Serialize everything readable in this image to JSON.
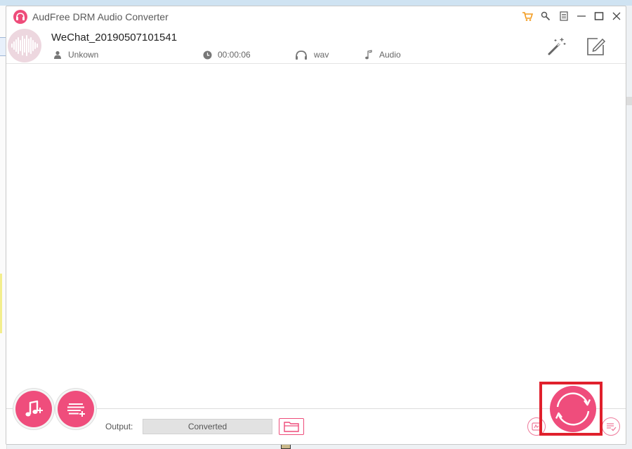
{
  "app": {
    "title": "AudFree DRM Audio Converter",
    "accent_color": "#ef4d7c"
  },
  "window_controls": [
    {
      "name": "cart-icon"
    },
    {
      "name": "register-key-icon"
    },
    {
      "name": "menu-icon"
    },
    {
      "name": "minimize-icon"
    },
    {
      "name": "maximize-icon"
    },
    {
      "name": "close-icon"
    }
  ],
  "track": {
    "title": "WeChat_20190507101541",
    "artist": "Unkown",
    "duration": "00:00:06",
    "format": "wav",
    "type": "Audio"
  },
  "tools": {
    "edit_effects_icon": "magic-wand-icon",
    "edit_tags_icon": "edit-icon"
  },
  "bottom": {
    "output_label": "Output:",
    "output_value": "Converted",
    "add_music_icon": "add-music-icon",
    "add_playlist_icon": "add-playlist-icon",
    "folder_icon": "folder-icon",
    "convert_icon": "convert-icon"
  },
  "highlight_color": "#e0202c"
}
